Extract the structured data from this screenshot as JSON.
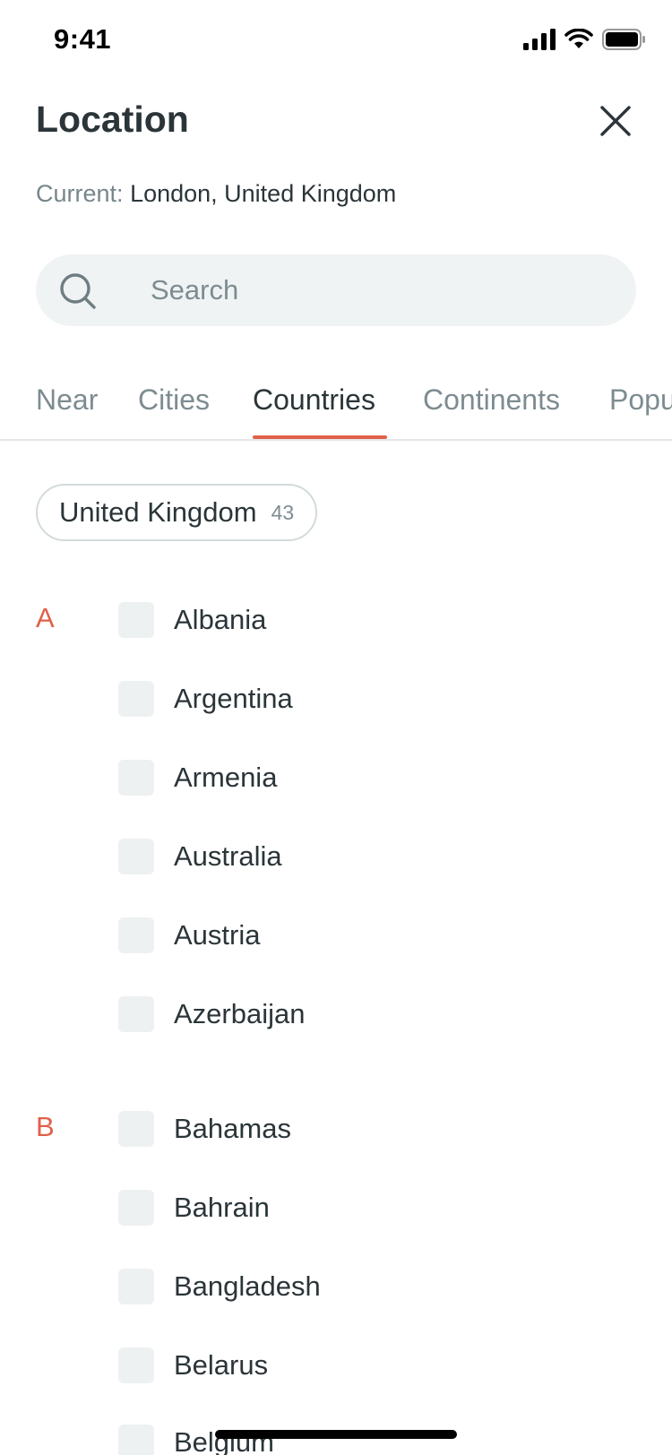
{
  "status_bar": {
    "time": "9:41"
  },
  "header": {
    "title": "Location"
  },
  "current": {
    "label": "Current:",
    "value": "London, United Kingdom"
  },
  "search": {
    "placeholder": "Search",
    "value": ""
  },
  "tabs": [
    {
      "label": "Near"
    },
    {
      "label": "Cities"
    },
    {
      "label": "Countries",
      "active": true
    },
    {
      "label": "Continents"
    },
    {
      "label": "Popu"
    }
  ],
  "chip": {
    "label": "United Kingdom",
    "count": "43"
  },
  "sections": [
    {
      "letter": "A",
      "items": [
        "Albania",
        "Argentina",
        "Armenia",
        "Australia",
        "Austria",
        "Azerbaijan"
      ]
    },
    {
      "letter": "B",
      "items": [
        "Bahamas",
        "Bahrain",
        "Bangladesh",
        "Belarus",
        "Belgium"
      ]
    }
  ],
  "colors": {
    "accent": "#e0604a",
    "text": "#2b3539",
    "muted": "#7e8c91",
    "field_bg": "#f0f3f4"
  }
}
